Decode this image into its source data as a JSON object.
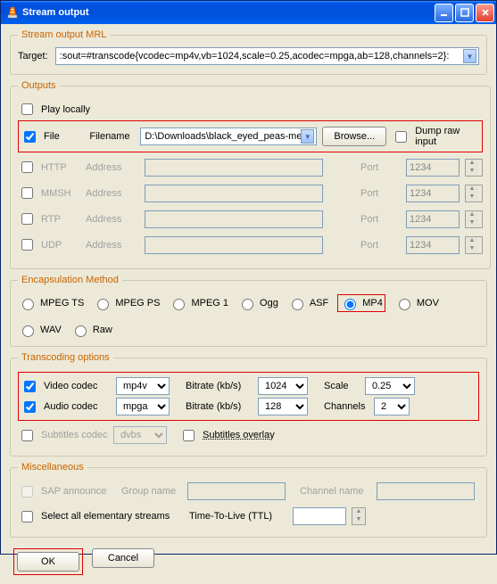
{
  "window": {
    "title": "Stream output"
  },
  "mrl": {
    "legend": "Stream output MRL",
    "target_label": "Target:",
    "target_value": ":sout=#transcode{vcodec=mp4v,vb=1024,scale=0.25,acodec=mpga,ab=128,channels=2}:"
  },
  "outputs": {
    "legend": "Outputs",
    "play_locally": "Play locally",
    "file": "File",
    "filename_label": "Filename",
    "filename_value": "D:\\Downloads\\black_eyed_peas-mec",
    "browse": "Browse...",
    "dump_raw": "Dump raw input",
    "http": "HTTP",
    "mmsh": "MMSH",
    "rtp": "RTP",
    "udp": "UDP",
    "address": "Address",
    "port": "Port",
    "port_placeholder": "1234"
  },
  "encap": {
    "legend": "Encapsulation Method",
    "options": [
      "MPEG TS",
      "MPEG PS",
      "MPEG 1",
      "Ogg",
      "ASF",
      "MP4",
      "MOV",
      "WAV",
      "Raw"
    ]
  },
  "transcode": {
    "legend": "Transcoding options",
    "video_codec": "Video codec",
    "video_codec_val": "mp4v",
    "audio_codec": "Audio codec",
    "audio_codec_val": "mpga",
    "bitrate": "Bitrate (kb/s)",
    "video_bitrate_val": "1024",
    "audio_bitrate_val": "128",
    "scale": "Scale",
    "scale_val": "0.25",
    "channels": "Channels",
    "channels_val": "2",
    "subtitles_codec": "Subtitles codec",
    "subtitles_codec_val": "dvbs",
    "subtitles_overlay": "Subtitles overlay"
  },
  "misc": {
    "legend": "Miscellaneous",
    "sap": "SAP announce",
    "group_name": "Group name",
    "channel_name": "Channel name",
    "select_all": "Select all elementary streams",
    "ttl": "Time-To-Live (TTL)"
  },
  "buttons": {
    "ok": "OK",
    "cancel": "Cancel"
  }
}
